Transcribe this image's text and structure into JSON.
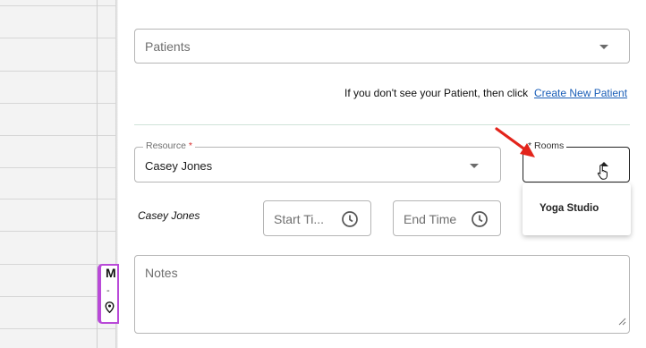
{
  "calendar": {
    "event": {
      "title": "M",
      "dash": "-",
      "icon": "location-pin-icon",
      "accent": "#b94ad8"
    }
  },
  "form": {
    "patients": {
      "placeholder": "Patients",
      "icon": "chevron-down-icon"
    },
    "hint": {
      "text": "If you don't see your Patient, then click",
      "link": "Create New Patient"
    },
    "resource": {
      "label": "Resource",
      "required_mark": "*",
      "value": "Casey Jones",
      "icon": "chevron-down-icon"
    },
    "rooms": {
      "label": "Rooms",
      "required_mark": "*",
      "icon": "chevron-up-icon",
      "options": [
        "Yoga Studio"
      ]
    },
    "schedule": {
      "resource_name": "Casey Jones",
      "start": {
        "placeholder": "Start Ti...",
        "icon": "clock-icon"
      },
      "end": {
        "placeholder": "End Time",
        "icon": "clock-icon"
      }
    },
    "notes": {
      "placeholder": "Notes",
      "icon": "resize-handle-icon"
    }
  },
  "annotation": {
    "icon": "red-arrow-icon",
    "color": "#e3241b"
  }
}
